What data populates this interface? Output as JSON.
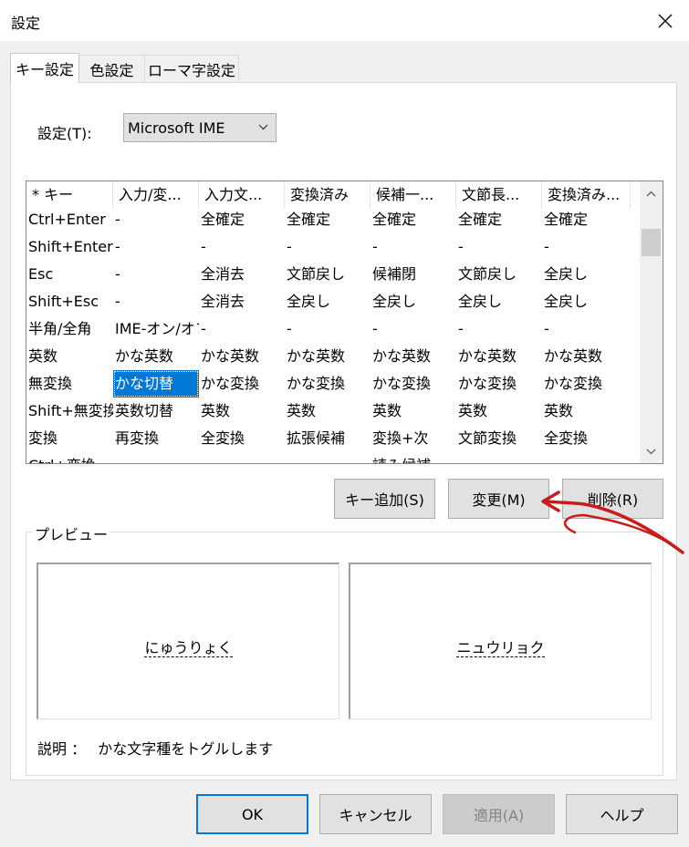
{
  "window": {
    "title": "設定"
  },
  "tabs": [
    "キー設定",
    "色設定",
    "ローマ字設定"
  ],
  "setting": {
    "label": "設定(T):",
    "value": "Microsoft IME"
  },
  "keytable": {
    "headers": [
      "* キー",
      "入力/変...",
      "入力文...",
      "変換済み",
      "候補一...",
      "文節長...",
      "変換済み..."
    ],
    "rows": [
      [
        "Ctrl+Enter",
        "-",
        "全確定",
        "全確定",
        "全確定",
        "全確定",
        "全確定"
      ],
      [
        "Shift+Enter",
        "-",
        "-",
        "-",
        "-",
        "-",
        "-"
      ],
      [
        "Esc",
        "-",
        "全消去",
        "文節戻し",
        "候補閉",
        "文節戻し",
        "全戻し"
      ],
      [
        "Shift+Esc",
        "-",
        "全消去",
        "全戻し",
        "全戻し",
        "全戻し",
        "全戻し"
      ],
      [
        "半角/全角",
        "IME-オン/オフ",
        "-",
        "-",
        "-",
        "-",
        "-"
      ],
      [
        "英数",
        "かな英数",
        "かな英数",
        "かな英数",
        "かな英数",
        "かな英数",
        "かな英数"
      ],
      [
        "無変換",
        "かな切替",
        "かな変換",
        "かな変換",
        "かな変換",
        "かな変換",
        "かな変換"
      ],
      [
        "Shift+無変換",
        "英数切替",
        "英数",
        "英数",
        "英数",
        "英数",
        "英数"
      ],
      [
        "変換",
        "再変換",
        "全変換",
        "拡張候補",
        "変換+次",
        "文節変換",
        "全変換"
      ],
      [
        "Ctrl+変換",
        "-",
        "-",
        "-",
        "読み候補",
        "-",
        "-"
      ]
    ],
    "selected": {
      "row": 6,
      "col": 1
    }
  },
  "buttons": {
    "add_key": "キー追加(S)",
    "change": "変更(M)",
    "delete": "削除(R)"
  },
  "preview": {
    "title": "プレビュー",
    "left_text": "にゅうりょく",
    "right_text": "ニュウリョク"
  },
  "description": {
    "label": "説明 ：",
    "text": "かな文字種をトグルします"
  },
  "footer": {
    "ok": "OK",
    "cancel": "キャンセル",
    "apply": "適用(A)",
    "help": "ヘルプ"
  },
  "colors": {
    "selection": "#0078d7",
    "annotation_arrow": "#cc1a1a"
  },
  "icons": [
    "close-icon",
    "chevron-down-icon",
    "scroll-up-icon",
    "scroll-down-icon"
  ]
}
